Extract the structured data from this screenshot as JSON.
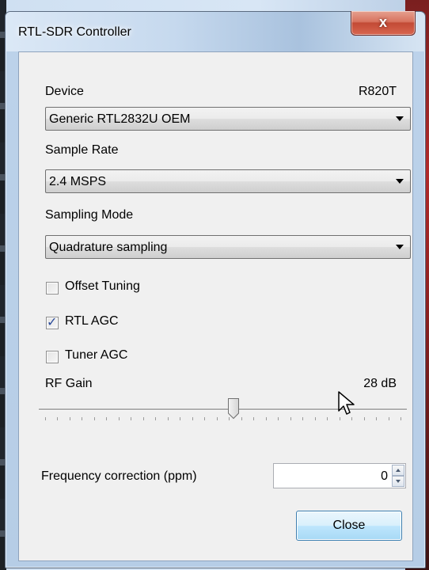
{
  "window": {
    "title": "RTL-SDR Controller",
    "close_glyph": "x"
  },
  "device": {
    "label": "Device",
    "tuner": "R820T",
    "selected": "Generic RTL2832U OEM"
  },
  "sample_rate": {
    "label": "Sample Rate",
    "selected": "2.4 MSPS"
  },
  "sampling_mode": {
    "label": "Sampling Mode",
    "selected": "Quadrature sampling"
  },
  "options": {
    "offset_tuning": {
      "label": "Offset Tuning",
      "checked": false
    },
    "rtl_agc": {
      "label": "RTL AGC",
      "checked": true,
      "mark": "✓"
    },
    "tuner_agc": {
      "label": "Tuner AGC",
      "checked": false
    }
  },
  "rf_gain": {
    "label": "RF Gain",
    "value_text": "28 dB",
    "slider_fraction": 0.53
  },
  "frequency_correction": {
    "label": "Frequency correction (ppm)",
    "value": "0"
  },
  "buttons": {
    "close": "Close"
  },
  "colors": {
    "client_bg": "#f0f0f0",
    "close_button_accent": "#3c7fb1",
    "title_close_red": "#c24a35"
  }
}
